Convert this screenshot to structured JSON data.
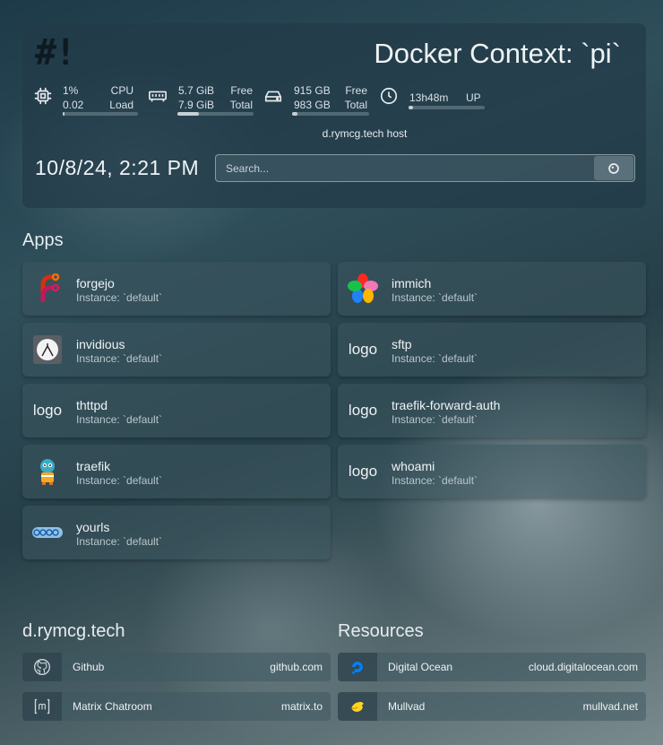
{
  "header": {
    "logo_text": "#!",
    "title": "Docker Context: `pi`",
    "host_label": "d.rymcg.tech host",
    "datetime": "10/8/24, 2:21 PM"
  },
  "stats": {
    "cpu": {
      "value1": "1%",
      "label1": "CPU",
      "value2": "0.02",
      "label2": "Load",
      "fill": 0.02
    },
    "memory": {
      "value1": "5.7 GiB",
      "label1": "Free",
      "value2": "7.9 GiB",
      "label2": "Total",
      "fill": 0.28
    },
    "disk": {
      "value1": "915 GB",
      "label1": "Free",
      "value2": "983 GB",
      "label2": "Total",
      "fill": 0.07
    },
    "uptime": {
      "value1": "13h48m",
      "label1": "UP",
      "fill": 0.06
    }
  },
  "search": {
    "placeholder": "Search..."
  },
  "apps": {
    "title": "Apps",
    "items": [
      {
        "name": "forgejo",
        "instance": "Instance: `default`",
        "logo": "forgejo-icon"
      },
      {
        "name": "immich",
        "instance": "Instance: `default`",
        "logo": "immich-icon"
      },
      {
        "name": "invidious",
        "instance": "Instance: `default`",
        "logo": "invidious-icon"
      },
      {
        "name": "sftp",
        "instance": "Instance: `default`",
        "logo_text": "logo"
      },
      {
        "name": "thttpd",
        "instance": "Instance: `default`",
        "logo_text": "logo"
      },
      {
        "name": "traefik-forward-auth",
        "instance": "Instance: `default`",
        "logo_text": "logo"
      },
      {
        "name": "traefik",
        "instance": "Instance: `default`",
        "logo": "traefik-icon"
      },
      {
        "name": "whoami",
        "instance": "Instance: `default`",
        "logo_text": "logo"
      },
      {
        "name": "yourls",
        "instance": "Instance: `default`",
        "logo": "yourls-icon"
      }
    ]
  },
  "bookmarks": {
    "groups": [
      {
        "title": "d.rymcg.tech",
        "items": [
          {
            "name": "Github",
            "url": "github.com",
            "icon": "github-icon"
          },
          {
            "name": "Matrix Chatroom",
            "url": "matrix.to",
            "icon": "matrix-icon"
          }
        ]
      },
      {
        "title": "Resources",
        "items": [
          {
            "name": "Digital Ocean",
            "url": "cloud.digitalocean.com",
            "icon": "digitalocean-icon"
          },
          {
            "name": "Mullvad",
            "url": "mullvad.net",
            "icon": "mullvad-icon"
          }
        ]
      }
    ]
  }
}
